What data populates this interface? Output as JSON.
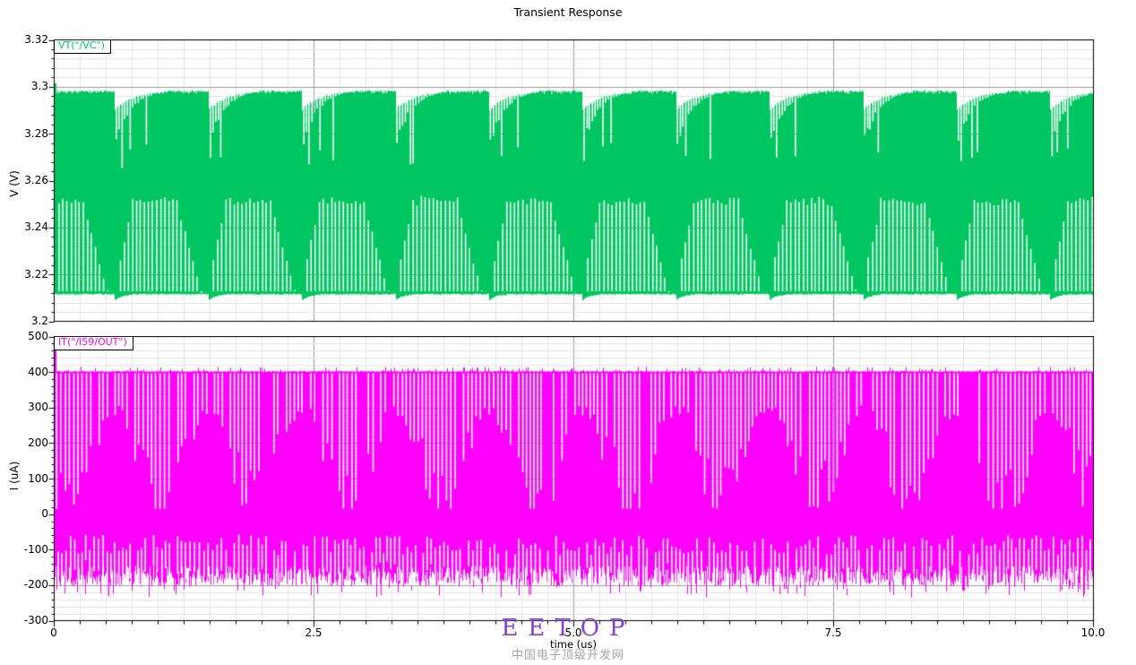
{
  "title": "Transient Response",
  "xaxis": {
    "label": "time (us)",
    "tick_labels": [
      "0",
      "2.5",
      "5.0",
      "7.5",
      "10.0"
    ],
    "tick_values": [
      0,
      2.5,
      5.0,
      7.5,
      10.0
    ],
    "minor_step_us": 0.25,
    "xlim": [
      0,
      10
    ]
  },
  "watermark": {
    "text": "EETOP",
    "subtext": "中国电子顶级开发网",
    "color": "#8640cf",
    "sub_color": "#a6a6a6"
  },
  "colors": {
    "green": "#00c661",
    "magenta": "#ff00ff",
    "grid_minor": "#e4e4e4",
    "grid_major": "#9c9c9c",
    "axis": "#000000"
  },
  "chart_data": [
    {
      "type": "area",
      "panel": "top",
      "trace_label": "VT(\"/VC\")",
      "ylabel": "V (V)",
      "ylim": [
        3.2,
        3.32
      ],
      "ytick_labels": [
        "3.32",
        "3.3",
        "3.28",
        "3.26",
        "3.24",
        "3.22",
        "3.2"
      ],
      "ytick_values": [
        3.32,
        3.3,
        3.28,
        3.26,
        3.24,
        3.22,
        3.2
      ],
      "y_minor_step": 0.004,
      "waveform": {
        "description": "dense switching ripple band: solid fill between envelopes with periodic notch-and-recovery at top and comb of narrow dips rising from bottom",
        "top_envelope_v": 3.2985,
        "start_spike_v": 3.3015,
        "notch_period_us": 0.9,
        "first_notch_us": 0.577,
        "notch_drop_v": 3.2905,
        "recovery_deep_gap_v": 3.272,
        "recovery_len_us": 0.43,
        "lower_stripe_top_v": 3.2515,
        "lower_stripe_spacing_us": 0.039,
        "bottom_envelope_v": 3.2115,
        "bottom_dip_v": 3.209
      }
    },
    {
      "type": "area",
      "panel": "bottom",
      "trace_label": "IT(\"/I59/OUT\")",
      "ylabel": "I (uA)",
      "ylim": [
        -300,
        500
      ],
      "ytick_labels": [
        "500",
        "400",
        "300",
        "200",
        "100",
        "0",
        "-100",
        "-200",
        "-300"
      ],
      "ytick_values": [
        500,
        400,
        300,
        200,
        100,
        0,
        -100,
        -200,
        -300
      ],
      "y_minor_step": 20,
      "waveform": {
        "description": "dense bidirectional current spikes: flat top envelope at 400uA, solid core ~+20..-120uA, downward spikes to ~-235uA, comb gaps modulated at 0.9us pattern period",
        "top_envelope_ua": 400,
        "top_spike_max_ua": 415,
        "first_spike_ua": 463,
        "core_top_ua": 20,
        "core_bottom_ua": -120,
        "bottom_envelope_ua": -150,
        "bottom_spike_min_ua": -235,
        "gap_spacing_us": 0.038,
        "pattern_period_us": 0.9
      }
    }
  ]
}
